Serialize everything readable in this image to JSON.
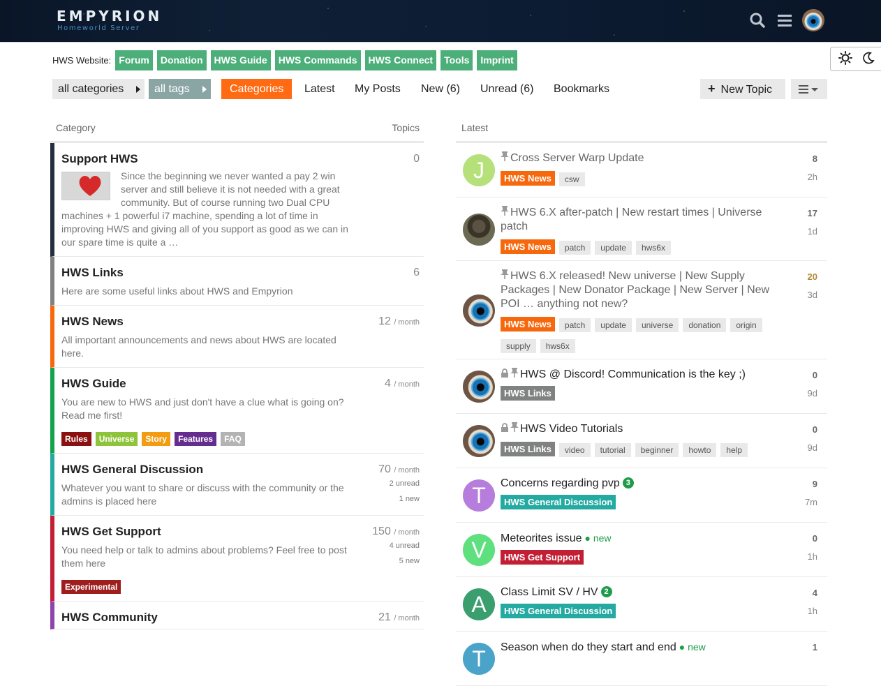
{
  "header": {
    "logo_title": "EMPYRION",
    "logo_subtitle": "Homeworld Server"
  },
  "links_bar": {
    "label": "HWS Website:",
    "links": [
      "Forum",
      "Donation",
      "HWS Guide",
      "HWS Commands",
      "HWS Connect",
      "Tools",
      "Imprint"
    ]
  },
  "nav": {
    "all_categories": "all categories",
    "all_tags": "all tags",
    "items": [
      "Categories",
      "Latest",
      "My Posts",
      "New (6)",
      "Unread (6)",
      "Bookmarks"
    ],
    "new_topic": "New Topic"
  },
  "categories": {
    "col_category": "Category",
    "col_topics": "Topics",
    "rows": [
      {
        "name": "Support HWS",
        "desc": "Since the beginning we never wanted a pay 2 win server and still believe it is not needed with a great community. But of course running two Dual CPU machines + 1 powerful i7 machine, spending a lot of time in improving HWS and giving all of you support as good as we can in our spare time is quite a …",
        "topics": "0",
        "per": "",
        "unread": "",
        "new": "",
        "color": "#232f3e",
        "badges": []
      },
      {
        "name": "HWS Links",
        "desc": "Here are some useful links about HWS and Empyrion",
        "topics": "6",
        "per": "",
        "unread": "",
        "new": "",
        "color": "#808281",
        "badges": []
      },
      {
        "name": "HWS News",
        "desc": "All important announcements and news about HWS are located here.",
        "topics": "12",
        "per": "/ month",
        "unread": "",
        "new": "",
        "color": "#f7680d",
        "badges": []
      },
      {
        "name": "HWS Guide",
        "desc": "You are new to HWS and just don't have a clue what is going on? Read me first!",
        "topics": "4",
        "per": "/ month",
        "unread": "",
        "new": "",
        "color": "#12a24c",
        "badges": [
          {
            "label": "Rules",
            "color": "#8b1010"
          },
          {
            "label": "Universe",
            "color": "#8fc33a"
          },
          {
            "label": "Story",
            "color": "#f39c12"
          },
          {
            "label": "Features",
            "color": "#652d90"
          },
          {
            "label": "FAQ",
            "color": "#b3b3b3"
          }
        ]
      },
      {
        "name": "HWS General Discussion",
        "desc": "Whatever you want to share or discuss with the community or the admins is placed here",
        "topics": "70",
        "per": "/ month",
        "unread": "2 unread",
        "new": "1 new",
        "color": "#25aaa2",
        "badges": []
      },
      {
        "name": "HWS Get Support",
        "desc": "You need help or talk to admins about problems? Feel free to post them here",
        "topics": "150",
        "per": "/ month",
        "unread": "4 unread",
        "new": "5 new",
        "color": "#c21f35",
        "badges": [
          {
            "label": "Experimental",
            "color": "#9e1e1e"
          }
        ]
      },
      {
        "name": "HWS Community",
        "desc": "",
        "topics": "21",
        "per": "/ month",
        "unread": "",
        "new": "",
        "color": "#8e44ad",
        "badges": []
      }
    ]
  },
  "latest": {
    "col_latest": "Latest",
    "topics": [
      {
        "title": "Cross Server Warp Update",
        "pinned": true,
        "locked": false,
        "avatar": "J",
        "avatar_color": "#b6e07a",
        "category": "HWS News",
        "cat_color": "#f7680d",
        "tags": [
          "csw"
        ],
        "posts": "8",
        "hot": false,
        "age": "2h",
        "new_count": "",
        "is_new": false,
        "new_label": ""
      },
      {
        "title": "HWS 6.X after-patch | New restart times | Universe patch",
        "pinned": true,
        "locked": false,
        "avatar": "",
        "avatar_color": "soldier",
        "category": "HWS News",
        "cat_color": "#f7680d",
        "tags": [
          "patch",
          "update",
          "hws6x"
        ],
        "posts": "17",
        "hot": false,
        "age": "1d",
        "new_count": "",
        "is_new": false,
        "new_label": ""
      },
      {
        "title": "HWS 6.X released! New universe | New Supply Packages | New Donator Package | New Server | New POI … anything not new?",
        "pinned": true,
        "locked": false,
        "avatar": "",
        "avatar_color": "eye",
        "category": "HWS News",
        "cat_color": "#f7680d",
        "tags": [
          "patch",
          "update",
          "universe",
          "donation",
          "origin",
          "supply",
          "hws6x"
        ],
        "posts": "20",
        "hot": true,
        "age": "3d",
        "new_count": "",
        "is_new": false,
        "new_label": ""
      },
      {
        "title": "HWS @ Discord! Communication is the key ;)",
        "pinned": true,
        "locked": true,
        "avatar": "",
        "avatar_color": "eye",
        "category": "HWS Links",
        "cat_color": "#808281",
        "tags": [],
        "posts": "0",
        "hot": false,
        "age": "9d",
        "new_count": "",
        "is_new": false,
        "new_label": ""
      },
      {
        "title": "HWS Video Tutorials",
        "pinned": true,
        "locked": true,
        "avatar": "",
        "avatar_color": "eye",
        "category": "HWS Links",
        "cat_color": "#808281",
        "tags": [
          "video",
          "tutorial",
          "beginner",
          "howto",
          "help"
        ],
        "posts": "0",
        "hot": false,
        "age": "9d",
        "new_count": "",
        "is_new": false,
        "new_label": ""
      },
      {
        "title": "Concerns regarding pvp",
        "pinned": false,
        "locked": false,
        "avatar": "T",
        "avatar_color": "#b77ddc",
        "category": "HWS General Discussion",
        "cat_color": "#25aaa2",
        "tags": [],
        "posts": "9",
        "hot": false,
        "age": "7m",
        "new_count": "3",
        "is_new": false,
        "new_label": ""
      },
      {
        "title": "Meteorites issue",
        "pinned": false,
        "locked": false,
        "avatar": "V",
        "avatar_color": "#5fe07f",
        "category": "HWS Get Support",
        "cat_color": "#c21f35",
        "tags": [],
        "posts": "0",
        "hot": false,
        "age": "1h",
        "new_count": "",
        "is_new": true,
        "new_label": "new"
      },
      {
        "title": "Class Limit SV / HV",
        "pinned": false,
        "locked": false,
        "avatar": "A",
        "avatar_color": "#3a9e6e",
        "category": "HWS General Discussion",
        "cat_color": "#25aaa2",
        "tags": [],
        "posts": "4",
        "hot": false,
        "age": "1h",
        "new_count": "2",
        "is_new": false,
        "new_label": ""
      },
      {
        "title": "Season when do they start and end",
        "pinned": false,
        "locked": false,
        "avatar": "T",
        "avatar_color": "#4aa3c9",
        "category": "",
        "cat_color": "",
        "tags": [],
        "posts": "1",
        "hot": false,
        "age": "",
        "new_count": "",
        "is_new": true,
        "new_label": "new"
      }
    ]
  }
}
